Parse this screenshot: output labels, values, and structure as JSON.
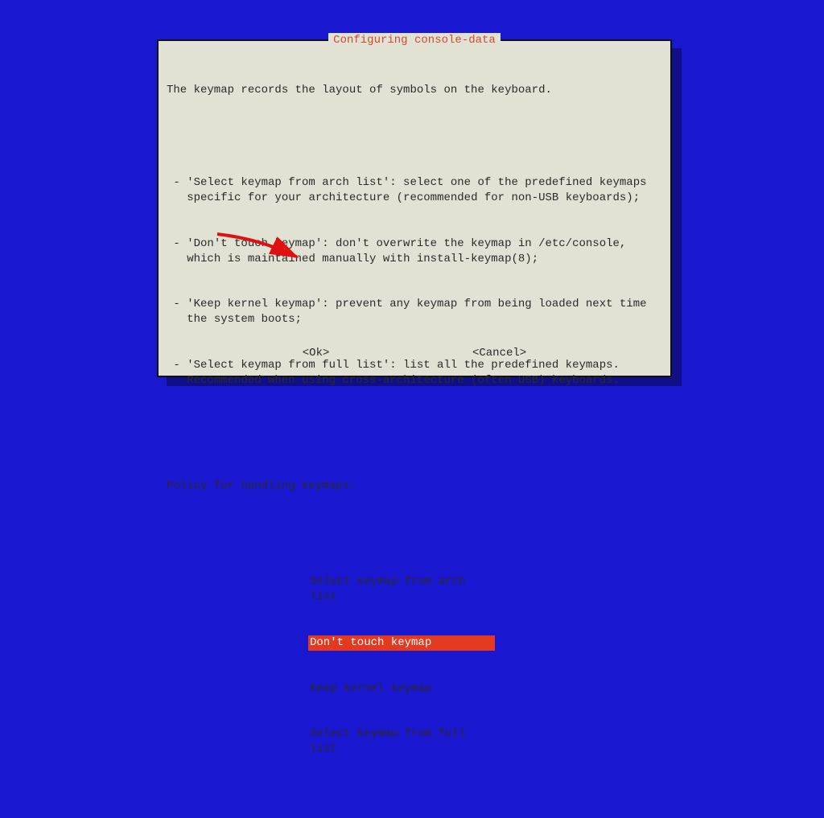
{
  "dialog": {
    "title": "Configuring console-data",
    "intro": "The keymap records the layout of symbols on the keyboard.",
    "bullets": [
      " - 'Select keymap from arch list': select one of the predefined keymaps\n   specific for your architecture (recommended for non-USB keyboards);",
      " - 'Don't touch keymap': don't overwrite the keymap in /etc/console,\n   which is maintained manually with install-keymap(8);",
      " - 'Keep kernel keymap': prevent any keymap from being loaded next time\n   the system boots;",
      " - 'Select keymap from full list': list all the predefined keymaps.\n   Recommended when using cross-architecture (often USB) keyboards."
    ],
    "prompt": "Policy for handling keymaps:",
    "menu": {
      "items": [
        {
          "label": "Select keymap from arch list",
          "selected": false
        },
        {
          "label": "Don't touch keymap",
          "selected": true
        },
        {
          "label": "Keep kernel keymap",
          "selected": false
        },
        {
          "label": "Select keymap from full list",
          "selected": false
        }
      ]
    },
    "ok_label": "<Ok>",
    "cancel_label": "<Cancel>"
  },
  "colors": {
    "background": "#1a17d1",
    "panel": "#e1e2d3",
    "title": "#d04a2f",
    "highlight_bg": "#e33a1f",
    "highlight_fg": "#ffffff"
  }
}
